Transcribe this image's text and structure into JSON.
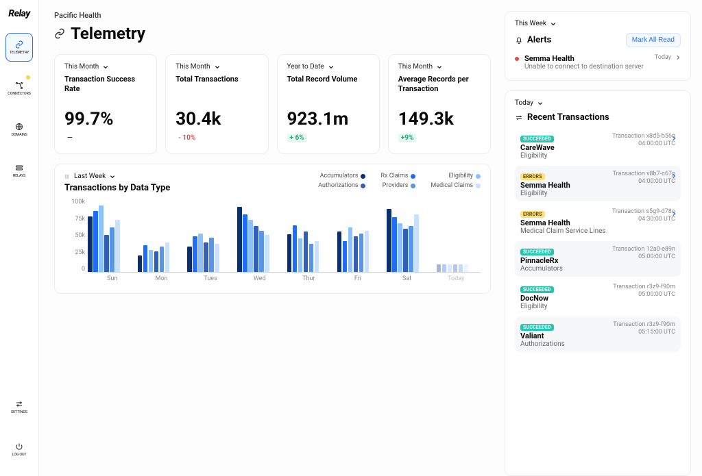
{
  "brand": "Relay",
  "sidebar": {
    "items": [
      {
        "label": "TELEMETRY"
      },
      {
        "label": "CONNECTORS"
      },
      {
        "label": "DOMAINS"
      },
      {
        "label": "RELAYS"
      }
    ],
    "bottom": [
      {
        "label": "SETTINGS"
      },
      {
        "label": "LOG OUT"
      }
    ]
  },
  "breadcrumb": "Pacific Health",
  "page_title": "Telemetry",
  "kpis": [
    {
      "range": "This Month",
      "title": "Transaction Success Rate",
      "value": "99.7%",
      "delta": "—",
      "delta_kind": "dash"
    },
    {
      "range": "This Month",
      "title": "Total Transactions",
      "value": "30.4k",
      "delta": "- 10%",
      "delta_kind": "neg"
    },
    {
      "range": "Year to Date",
      "title": "Total Record Volume",
      "value": "923.1m",
      "delta": "+ 6%",
      "delta_kind": "pos"
    },
    {
      "range": "This Month",
      "title": "Average Records per Transaction",
      "value": "149.3k",
      "delta": "+9%",
      "delta_kind": "pos"
    }
  ],
  "chart_data": {
    "type": "bar",
    "range_label": "Last Week",
    "title": "Transactions by Data Type",
    "ylabel": "",
    "ylim": [
      0,
      100
    ],
    "yticks": [
      "100k",
      "75k",
      "50k",
      "25k",
      "0"
    ],
    "categories": [
      "Sun",
      "Mon",
      "Tues",
      "Wed",
      "Thur",
      "Fri",
      "Sat",
      "Today"
    ],
    "series": [
      {
        "name": "Accumulators",
        "color": "#0b2e6f",
        "values": [
          75,
          22,
          34,
          88,
          51,
          55,
          85,
          10
        ]
      },
      {
        "name": "Rx Claims",
        "color": "#1f6dff",
        "values": [
          82,
          36,
          48,
          78,
          63,
          42,
          74,
          10
        ]
      },
      {
        "name": "Eligibility",
        "color": "#8ec2ff",
        "values": [
          90,
          30,
          52,
          70,
          45,
          60,
          66,
          10
        ]
      },
      {
        "name": "Authorizations",
        "color": "#335fb8",
        "values": [
          50,
          28,
          40,
          62,
          55,
          48,
          58,
          10
        ]
      },
      {
        "name": "Providers",
        "color": "#5a96e8",
        "values": [
          60,
          34,
          46,
          56,
          38,
          52,
          62,
          10
        ]
      },
      {
        "name": "Medical Claims",
        "color": "#c9e0ff",
        "values": [
          70,
          40,
          38,
          50,
          42,
          56,
          78,
          10
        ]
      }
    ]
  },
  "alerts": {
    "range": "This Week",
    "title": "Alerts",
    "mark_all": "Mark All Read",
    "items": [
      {
        "name": "Semma Health",
        "msg": "Unable to connect to destination server",
        "time": "Today"
      }
    ]
  },
  "transactions": {
    "range": "Today",
    "title": "Recent Transactions",
    "items": [
      {
        "status": "SUCCEEDED",
        "ok": true,
        "name": "CareWave",
        "type": "Eligibility",
        "tid": "Transaction x8d5-b56q",
        "time": "04:00:00 UTC",
        "chev": true,
        "alt": false
      },
      {
        "status": "ERRORS",
        "ok": false,
        "name": "Semma Health",
        "type": "Eligibility",
        "tid": "Transaction v8b7-c67p",
        "time": "04:00:00 UTC",
        "chev": true,
        "alt": true
      },
      {
        "status": "ERRORS",
        "ok": false,
        "name": "Semma Health",
        "type": "Medical Claim Service Lines",
        "tid": "Transaction s5g9-d78o",
        "time": "04:30:00 UTC",
        "chev": true,
        "alt": false
      },
      {
        "status": "SUCCEEDED",
        "ok": true,
        "name": "PinnacleRx",
        "type": "Accumulators",
        "tid": "Transaction 12a0-e89n",
        "time": "05:00:00 UTC",
        "chev": false,
        "alt": true
      },
      {
        "status": "SUCCEEDED",
        "ok": true,
        "name": "DocNow",
        "type": "Eligibility",
        "tid": "Transaction r3z9-f90m",
        "time": "05:00:00 UTC",
        "chev": false,
        "alt": false
      },
      {
        "status": "SUCCEEDED",
        "ok": true,
        "name": "Valiant",
        "type": "Authorizations",
        "tid": "Transaction r3z9-f90m",
        "time": "05:15:00 UTC",
        "chev": false,
        "alt": true
      }
    ]
  }
}
